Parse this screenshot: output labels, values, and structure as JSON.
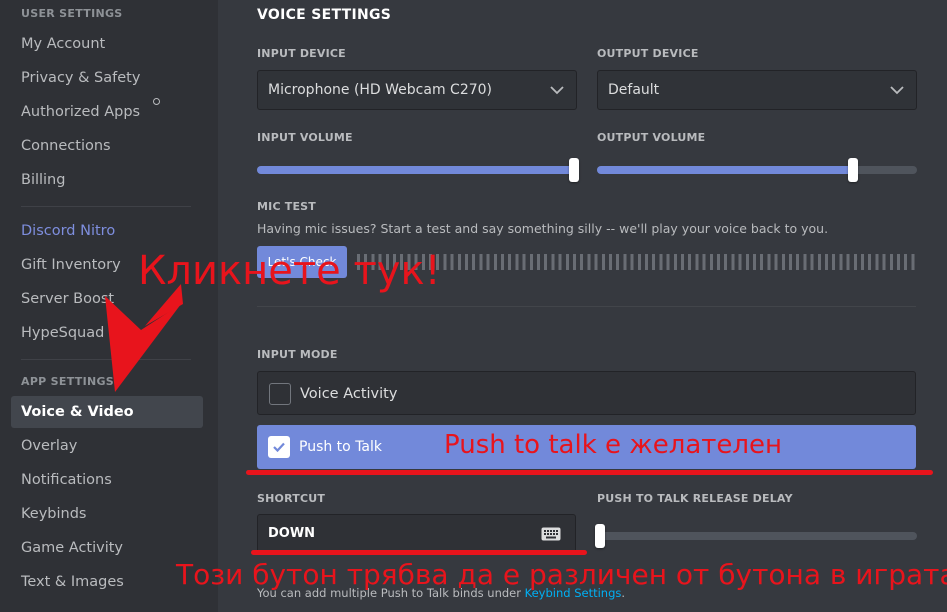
{
  "sidebar": {
    "user_settings_header": "USER SETTINGS",
    "items_user": [
      {
        "label": "My Account"
      },
      {
        "label": "Privacy & Safety"
      },
      {
        "label": "Authorized Apps"
      },
      {
        "label": "Connections"
      },
      {
        "label": "Billing"
      }
    ],
    "nitro": "Discord Nitro",
    "items_nitro": [
      {
        "label": "Gift Inventory"
      },
      {
        "label": "Server Boost"
      },
      {
        "label": "HypeSquad"
      }
    ],
    "app_settings_header": "APP SETTINGS",
    "items_app": [
      {
        "label": "Voice & Video",
        "selected": true
      },
      {
        "label": "Overlay"
      },
      {
        "label": "Notifications"
      },
      {
        "label": "Keybinds"
      },
      {
        "label": "Game Activity"
      },
      {
        "label": "Text & Images"
      }
    ]
  },
  "voice": {
    "title": "VOICE SETTINGS",
    "input_device_label": "INPUT DEVICE",
    "input_device_value": "Microphone (HD Webcam C270)",
    "output_device_label": "OUTPUT DEVICE",
    "output_device_value": "Default",
    "input_volume_label": "INPUT VOLUME",
    "input_volume": 0.99,
    "output_volume_label": "OUTPUT VOLUME",
    "output_volume": 0.8,
    "mic_test_label": "MIC TEST",
    "mic_test_desc": "Having mic issues? Start a test and say something silly -- we'll play your voice back to you.",
    "mic_test_button": "Let's Check",
    "input_mode_label": "INPUT MODE",
    "modes": [
      {
        "label": "Voice Activity",
        "checked": false
      },
      {
        "label": "Push to Talk",
        "checked": true
      }
    ],
    "shortcut_label": "SHORTCUT",
    "shortcut_value": "DOWN",
    "ptt_delay_label": "PUSH TO TALK RELEASE DELAY",
    "ptt_delay": 0.01,
    "footer_text": "You can add multiple Push to Talk binds under ",
    "footer_link": "Keybind Settings",
    "footer_end": "."
  },
  "annotations": {
    "click_here": "Кликнете тук!",
    "ptt_note": "Push to talk е желателен",
    "shortcut_note": "Този бутон трябва да е различен от бутона в играта",
    "color": "#e8141c"
  },
  "colors": {
    "accent": "#7289da",
    "sidebar_bg": "#2f3136",
    "main_bg": "#36393f",
    "link": "#00b0f4"
  }
}
